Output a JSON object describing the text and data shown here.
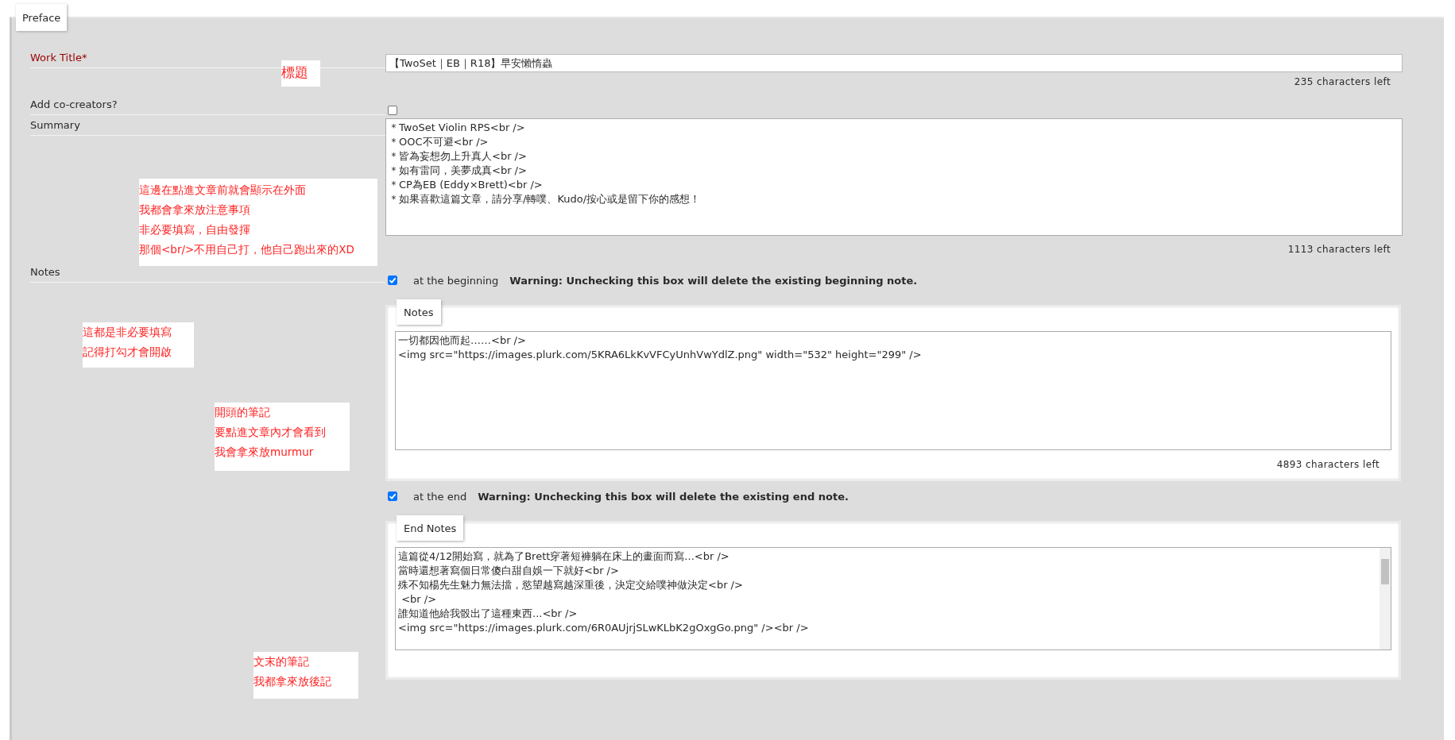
{
  "tab": {
    "label": "Preface",
    "selected": true
  },
  "work_title": {
    "label": "Work Title*",
    "value": "【TwoSet｜EB｜R18】早安懶惰蟲",
    "count": "235 characters left",
    "annotation": [
      "標題"
    ]
  },
  "co_creators": {
    "label": "Add co-creators?",
    "checked": false
  },
  "summary": {
    "label": "Summary",
    "lines": [
      "＊TwoSet Violin RPS<br />",
      "＊OOC不可避<br />",
      "＊皆為妄想勿上升真人<br />",
      "＊如有雷同，美夢成真<br />",
      "＊CP為EB (Eddy×Brett)<br />",
      "＊如果喜歡這篇文章，請分享/轉噗、Kudo/按心或是留下你的感想！"
    ],
    "count": "1113 characters left",
    "annotation": [
      "這邊在點進文章前就會顯示在外面",
      "我都會拿來放注意事項",
      "非必要填寫，自由發揮",
      "那個<br/>不用自己打，他自己跑出來的XD"
    ]
  },
  "notes": {
    "label": "Notes",
    "annotation": [
      "這都是非必要填寫",
      "記得打勾才會開啟"
    ],
    "beginning": {
      "checked": true,
      "label": "at the beginning",
      "warning": "Warning: Unchecking this box will delete the existing beginning note.",
      "legend": "Notes",
      "lines": [
        "一切都因他而起……<br />",
        "<img src=\"https://images.plurk.com/5KRA6LkKvVFCyUnhVwYdlZ.png\" width=\"532\" height=\"299\" />"
      ],
      "count": "4893 characters left",
      "annotation": [
        "開頭的筆記",
        "要點進文章內才會看到",
        "我會拿來放murmur"
      ]
    },
    "end": {
      "checked": true,
      "label": "at the end",
      "warning": "Warning: Unchecking this box will delete the existing end note.",
      "legend": "End Notes",
      "lines": [
        "這篇從4/12開始寫，就為了Brett穿著短褲躺在床上的畫面而寫...<br />",
        "當時還想著寫個日常傻白甜自娛一下就好<br />",
        "殊不知楊先生魅力無法擋，慾望越寫越深重後，決定交給噗神做決定<br />",
        " <br />",
        "誰知道他給我骰出了這種東西...<br />",
        "<img src=\"https://images.plurk.com/6R0AUjrjSLwKLbK2gOxgGo.png\" /><br />"
      ],
      "annotation": [
        "文末的筆記",
        "我都拿來放後記"
      ]
    }
  }
}
